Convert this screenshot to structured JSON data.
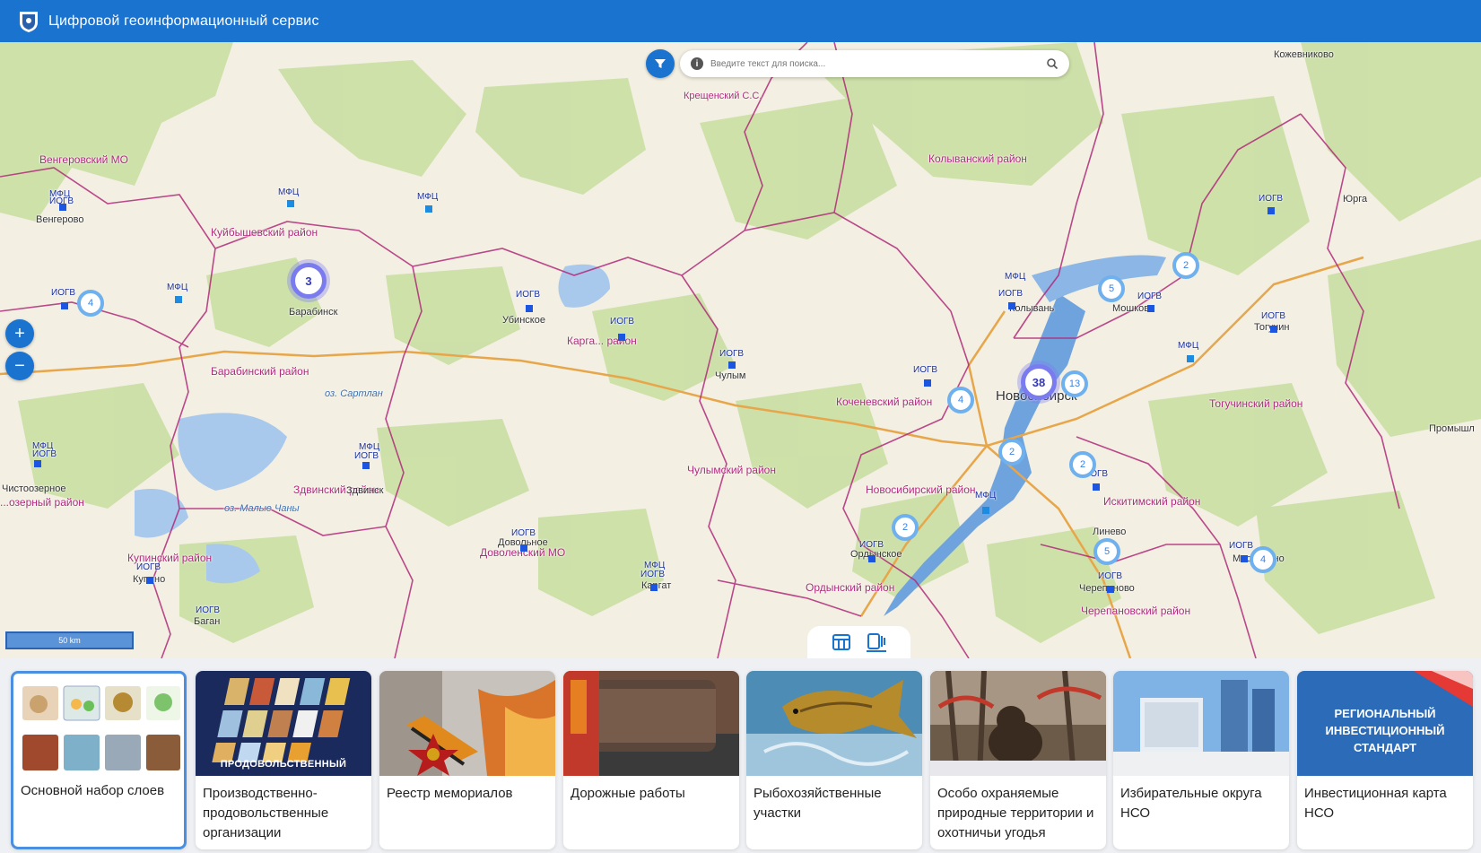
{
  "header": {
    "title": "Цифровой геоинформационный сервис"
  },
  "search": {
    "placeholder": "Введите текст для поиска..."
  },
  "map": {
    "scale_label": "50 km",
    "districts": [
      "Венгеровский МО",
      "Куйбышевский район",
      "Барабинский район",
      "Здвинский район",
      "Купинский район",
      "Доволенский МО",
      "Карга... район",
      "Чулымский район",
      "Коченевский район",
      "Колыванский район",
      "Новосибирский район",
      "Ордынский район",
      "Искитимский район",
      "Черепановский район",
      "Тогучинский район",
      "...озерный район"
    ],
    "places": [
      "Кожевниково",
      "Юрга",
      "Промышл",
      "Крещенский С.С.",
      "Венгерово",
      "Барабинск",
      "Убинское",
      "Чулым",
      "Здвинск",
      "Чистоозерное",
      "Купино",
      "Довольное",
      "Каргат",
      "Новосибирск",
      "Колывань",
      "Мошково",
      "Тогучин",
      "Линево",
      "Черепаново",
      "Маслянино",
      "Ордынское",
      "оз. Сартлан",
      "оз. Малые Чаны",
      "Баган"
    ],
    "poi_labels": {
      "mfc": "МФЦ",
      "iogv": "ИОГВ"
    },
    "clusters": [
      "3",
      "4",
      "38",
      "13",
      "4",
      "2",
      "2",
      "2",
      "5",
      "2",
      "5",
      "4"
    ]
  },
  "view_toggle": {
    "table": "table-icon",
    "panel": "side-panel-icon"
  },
  "layers": [
    {
      "label": "Основной набор слоев"
    },
    {
      "label": "Производственно-продовольственные организации",
      "banner": "ПРОДОВОЛЬСТВЕННЫЙ"
    },
    {
      "label": "Реестр мемориалов"
    },
    {
      "label": "Дорожные работы"
    },
    {
      "label": "Рыбохозяйственные участки"
    },
    {
      "label": "Особо охраняемые природные территории и охотничьи угодья"
    },
    {
      "label": "Избирательные округа НСО"
    },
    {
      "label": "Инвестиционная карта НСО",
      "banner": "РЕГИОНАЛЬНЫЙ ИНВЕСТИЦИОННЫЙ СТАНДАРТ"
    }
  ],
  "colors": {
    "accent": "#1b73d0",
    "boundary": "#b02a7a",
    "poi": "#1b55e0"
  }
}
